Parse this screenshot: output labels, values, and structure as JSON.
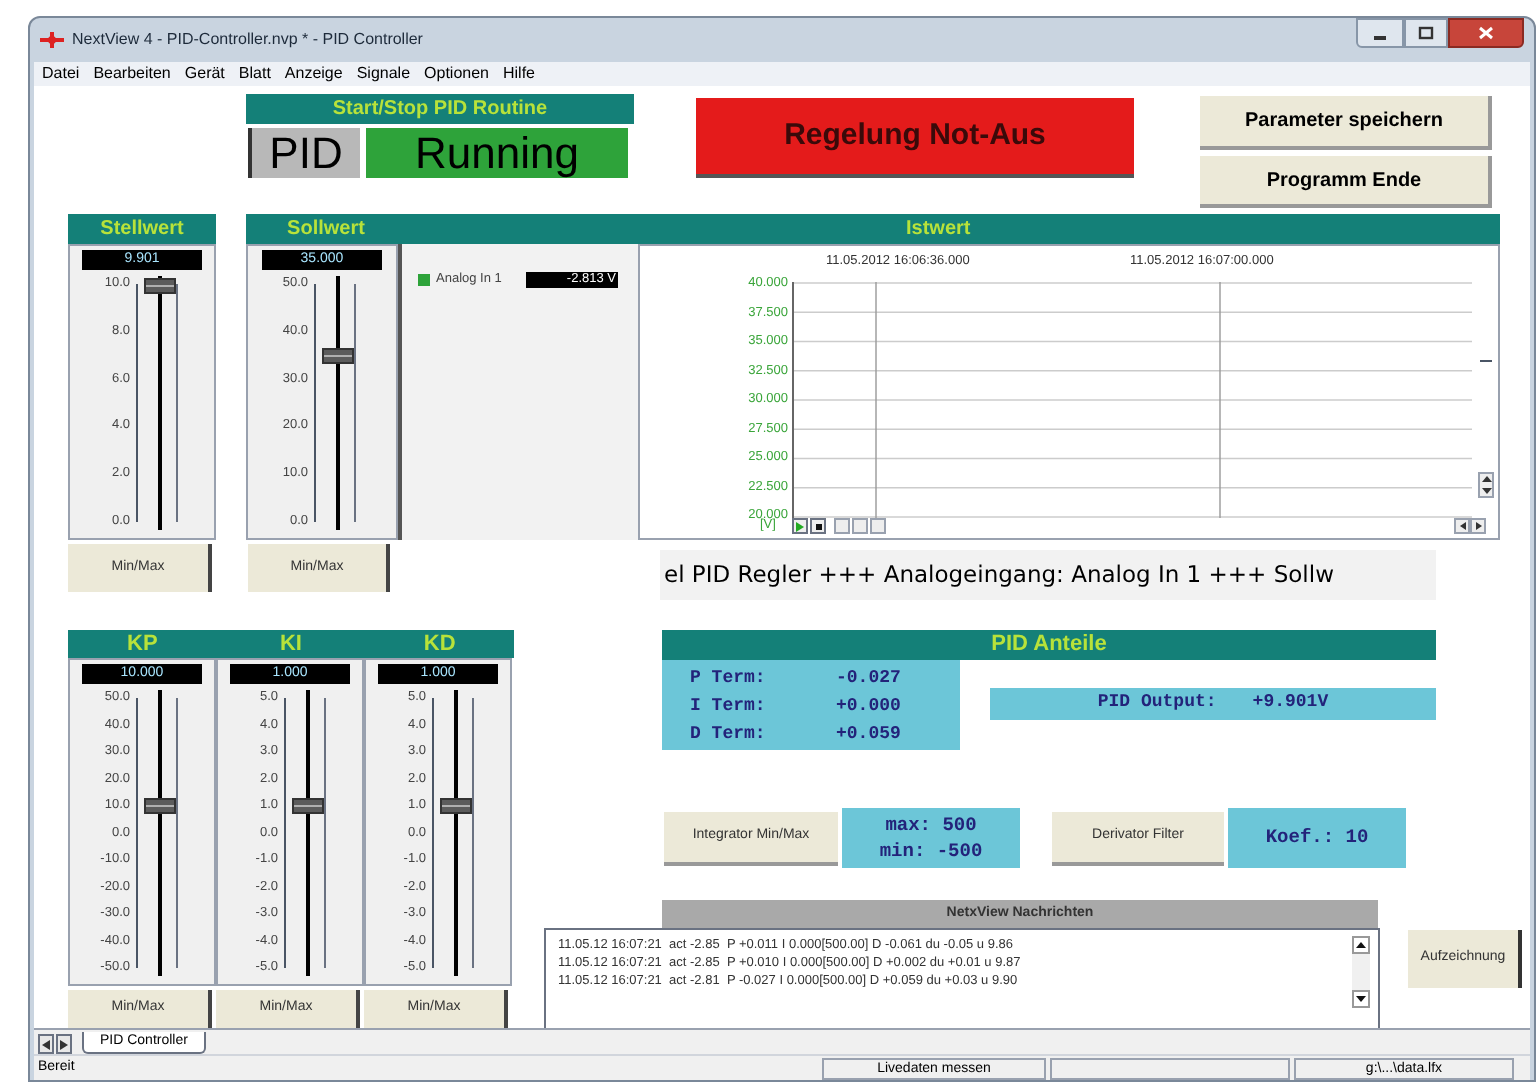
{
  "window": {
    "title": "NextView 4 - PID-Controller.nvp * - PID Controller"
  },
  "menu": [
    "Datei",
    "Bearbeiten",
    "Gerät",
    "Blatt",
    "Anzeige",
    "Signale",
    "Optionen",
    "Hilfe"
  ],
  "routine": {
    "header": "Start/Stop PID Routine",
    "label": "PID",
    "state": "Running",
    "running": true
  },
  "emergency_button": "Regelung Not-Aus",
  "buttons": [
    "Parameter speichern",
    "Programm Ende"
  ],
  "setpoints": [
    {
      "title": "Stellwert",
      "value": "9.901",
      "ticks": [
        "10.0",
        "8.0",
        "6.0",
        "4.0",
        "2.0",
        "0.0"
      ],
      "level": 0.99,
      "button": "Min/Max"
    },
    {
      "title": "Sollwert",
      "value": "35.000",
      "ticks": [
        "50.0",
        "40.0",
        "30.0",
        "20.0",
        "10.0",
        "0.0"
      ],
      "level": 0.7,
      "button": "Min/Max"
    }
  ],
  "chart_panel": {
    "title": "Istwert",
    "legend_name": "Analog In 1",
    "legend_value": "-2.813 V",
    "time_labels": [
      "11.05.2012 16:06:36.000",
      "11.05.2012 16:07:00.000"
    ],
    "y_ticks": [
      "40.000",
      "37.500",
      "35.000",
      "32.500",
      "30.000",
      "27.500",
      "25.000",
      "22.500",
      "20.000"
    ],
    "unit": "[V]"
  },
  "ticker": "el PID Regler +++ Analogeingang: Analog In 1 +++ Sollw",
  "gains": [
    {
      "title": "KP",
      "value": "10.000",
      "ticks": [
        "50.0",
        "40.0",
        "30.0",
        "20.0",
        "10.0",
        "0.0",
        "-10.0",
        "-20.0",
        "-30.0",
        "-40.0",
        "-50.0"
      ],
      "level": 0.6,
      "button": "Min/Max"
    },
    {
      "title": "KI",
      "value": "1.000",
      "ticks": [
        "5.0",
        "4.0",
        "3.0",
        "2.0",
        "1.0",
        "0.0",
        "-1.0",
        "-2.0",
        "-3.0",
        "-4.0",
        "-5.0"
      ],
      "level": 0.6,
      "button": "Min/Max"
    },
    {
      "title": "KD",
      "value": "1.000",
      "ticks": [
        "5.0",
        "4.0",
        "3.0",
        "2.0",
        "1.0",
        "0.0",
        "-1.0",
        "-2.0",
        "-3.0",
        "-4.0",
        "-5.0"
      ],
      "level": 0.6,
      "button": "Min/Max"
    }
  ],
  "pid_terms": {
    "title": "PID Anteile",
    "terms": [
      {
        "label": "P Term:",
        "value": "-0.027"
      },
      {
        "label": "I Term:",
        "value": "+0.000"
      },
      {
        "label": "D Term:",
        "value": "+0.059"
      }
    ],
    "output_label": "PID Output:",
    "output_value": "+9.901V"
  },
  "integrator": {
    "button": "Integrator Min/Max",
    "lines": [
      "max: 500",
      "min: -500"
    ]
  },
  "derivator": {
    "button": "Derivator Filter",
    "text": "Koef.: 10"
  },
  "messages": {
    "title": "NetxView Nachrichten",
    "lines": [
      "11.05.12 16:07:21  act -2.85  P +0.011 I 0.000[500.00] D -0.061 du -0.05 u 9.86",
      "11.05.12 16:07:21  act -2.85  P +0.010 I 0.000[500.00] D +0.002 du +0.01 u 9.87",
      "11.05.12 16:07:21  act -2.81  P -0.027 I 0.000[500.00] D +0.059 du +0.03 u 9.90"
    ]
  },
  "record_button": "Aufzeichnung",
  "tabs": [
    {
      "label": "PID Controller",
      "selected": true
    }
  ],
  "status_bar": {
    "left": "Bereit",
    "panels": [
      "Livedaten messen",
      "g:\\...\\data.lfx"
    ]
  }
}
